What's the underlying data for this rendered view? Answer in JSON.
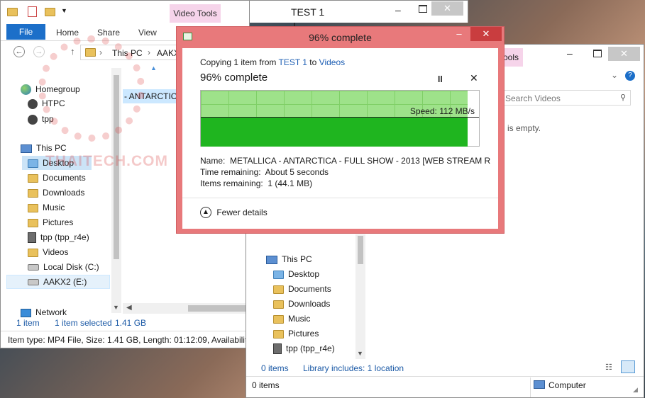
{
  "left_window": {
    "ribbon_tabs": [
      "File",
      "Home",
      "Share",
      "View"
    ],
    "context_tab": "Video Tools",
    "title": "TEST 1",
    "breadcrumb": [
      "This PC",
      "AAKX"
    ],
    "nav": [
      {
        "label": "Homegroup",
        "icon": "homegroup-icon"
      },
      {
        "label": "HTPC",
        "icon": "user-icon"
      },
      {
        "label": "tpp",
        "icon": "user-icon"
      },
      {
        "label": "This PC",
        "icon": "computer-icon"
      },
      {
        "label": "Desktop",
        "icon": "folder-icon"
      },
      {
        "label": "Documents",
        "icon": "folder-icon"
      },
      {
        "label": "Downloads",
        "icon": "folder-icon"
      },
      {
        "label": "Music",
        "icon": "folder-icon"
      },
      {
        "label": "Pictures",
        "icon": "folder-icon"
      },
      {
        "label": "tpp (tpp_r4e)",
        "icon": "network-drive-icon"
      },
      {
        "label": "Videos",
        "icon": "folder-icon"
      },
      {
        "label": "Local Disk (C:)",
        "icon": "disk-icon"
      },
      {
        "label": "AAKX2 (E:)",
        "icon": "disk-icon"
      },
      {
        "label": "Network",
        "icon": "network-icon"
      }
    ],
    "file_partial": "- ANTARCTIC",
    "status_items": "1 item",
    "status_selected": "1 item selected",
    "status_size": "1.41 GB",
    "details_bar": "Item type: MP4 File, Size: 1.41 GB, Length: 01:12:09, Availability: A"
  },
  "right_window": {
    "context_tab_partial": "ools",
    "search_placeholder": "Search Videos",
    "empty_text": "is empty.",
    "nav": [
      {
        "label": "This PC",
        "icon": "computer-icon"
      },
      {
        "label": "Desktop",
        "icon": "folder-icon"
      },
      {
        "label": "Documents",
        "icon": "folder-icon"
      },
      {
        "label": "Downloads",
        "icon": "folder-icon"
      },
      {
        "label": "Music",
        "icon": "folder-icon"
      },
      {
        "label": "Pictures",
        "icon": "folder-icon"
      },
      {
        "label": "tpp (tpp_r4e)",
        "icon": "network-drive-icon"
      }
    ],
    "status_items": "0 items",
    "library_includes": "Library includes: 1 location"
  },
  "bottom_status": {
    "items": "0 items",
    "zone": "Computer"
  },
  "dialog": {
    "title": "96% complete",
    "copy_prefix": "Copying 1 item from ",
    "copy_from": "TEST 1",
    "copy_to_word": " to ",
    "copy_to": "Videos",
    "progress_heading": "96% complete",
    "progress_percent": 96,
    "speed": "Speed: 112 MB/s",
    "name_label": "Name:",
    "name_value": "METALLICA - ANTARCTICA - FULL SHOW - 2013 [WEB STREAM R...",
    "time_label": "Time remaining:",
    "time_value": "About 5 seconds",
    "items_label": "Items remaining:",
    "items_value": "1 (44.1 MB)",
    "fewer_details": "Fewer details",
    "accent_green": "#1fb51f",
    "graph_green": "#9ee28a",
    "link_color": "#1e5fb4"
  },
  "watermark": "THAITECH.COM"
}
